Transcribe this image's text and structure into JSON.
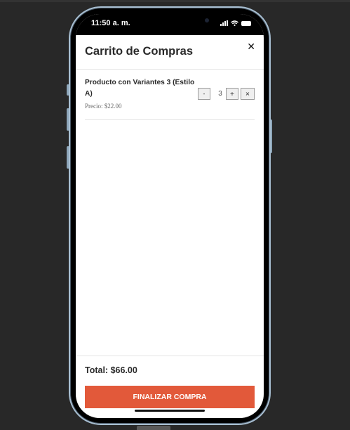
{
  "status_bar": {
    "time": "11:50 a. m.",
    "icons": [
      "signal-icon",
      "wifi-icon",
      "battery-icon"
    ]
  },
  "cart": {
    "title": "Carrito de Compras",
    "close_label": "✕",
    "items": [
      {
        "name": "Producto con Variantes 3 (Estilo A)",
        "price": "Precio: $22.00",
        "quantity": "3",
        "decrement_label": "-",
        "increment_label": "+",
        "remove_label": "×"
      }
    ],
    "total": "Total: $66.00",
    "checkout_label": "FINALIZAR COMPRA"
  },
  "colors": {
    "accent": "#e2593a",
    "background": "#282828",
    "phone_frame": "#a8bfd2"
  }
}
